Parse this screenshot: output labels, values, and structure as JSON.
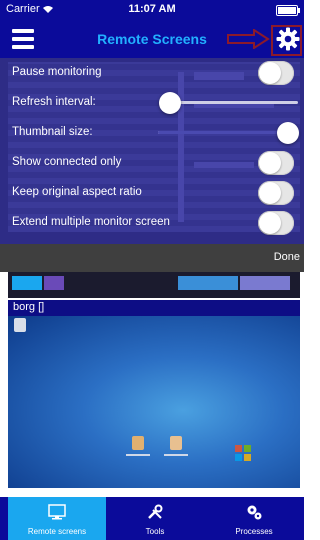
{
  "status_bar": {
    "carrier": "Carrier",
    "time": "11:07 AM"
  },
  "nav": {
    "title": "Remote Screens",
    "menu_icon": "hamburger-icon",
    "settings_icon": "gear-icon"
  },
  "settings": {
    "pause_monitoring": {
      "label": "Pause monitoring",
      "on": false
    },
    "refresh_interval": {
      "label": "Refresh interval:",
      "fraction": 0.0
    },
    "thumbnail_size": {
      "label": "Thumbnail size:",
      "fraction": 1.0
    },
    "show_connected_only": {
      "label": "Show connected only",
      "on": false
    },
    "keep_aspect_ratio": {
      "label": "Keep original aspect ratio",
      "on": false
    },
    "extend_monitor": {
      "label": "Extend multiple monitor screen",
      "on": false
    },
    "done_label": "Done"
  },
  "screens": [
    {
      "name": "borg []"
    }
  ],
  "tabs": [
    {
      "label": "Remote screens",
      "icon": "monitor-icon",
      "active": true
    },
    {
      "label": "Tools",
      "icon": "tools-icon",
      "active": false
    },
    {
      "label": "Processes",
      "icon": "gears-icon",
      "active": false
    }
  ],
  "colors": {
    "nav_background": "#0b0b9a",
    "title": "#22b0ff",
    "active_tab": "#1aa7ef",
    "annotation_box": "#8b1a2b"
  }
}
